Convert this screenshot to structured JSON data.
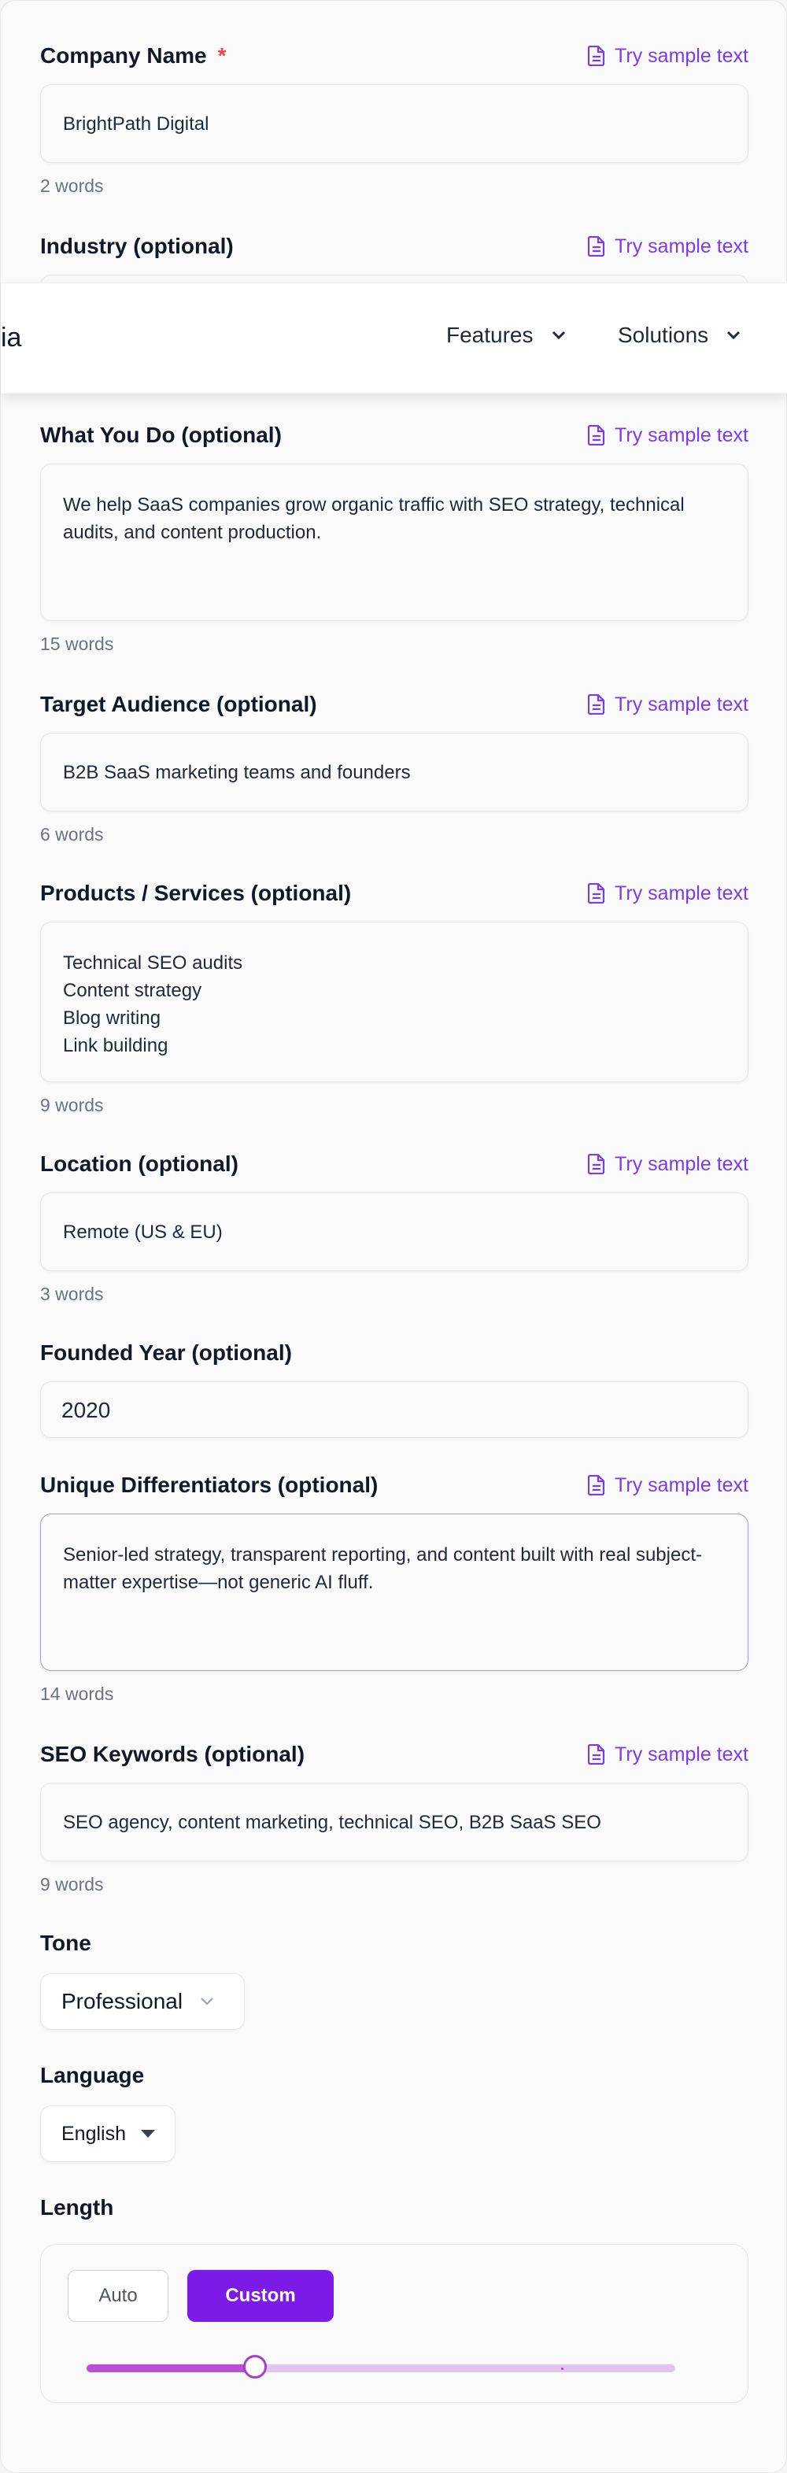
{
  "colors": {
    "accent": "#7c3aed",
    "required": "#ef4444",
    "custom_button": "#7c1ae8"
  },
  "try_sample_label": "Try sample text",
  "nav": {
    "logo_partial": "ia",
    "features_label": "Features",
    "solutions_label": "Solutions"
  },
  "company_name": {
    "label": "Company Name",
    "required_mark": "*",
    "value": "BrightPath Digital",
    "word_count": "2 words"
  },
  "industry": {
    "label": "Industry (optional)"
  },
  "what_you_do": {
    "label": "What You Do (optional)",
    "value": "We help SaaS companies grow organic traffic with SEO strategy, technical audits, and content production.",
    "word_count": "15 words"
  },
  "target_audience": {
    "label": "Target Audience (optional)",
    "value": "B2B SaaS marketing teams and founders",
    "word_count": "6 words"
  },
  "products_services": {
    "label": "Products / Services (optional)",
    "value": "Technical SEO audits\nContent strategy\nBlog writing\nLink building",
    "word_count": "9 words"
  },
  "location": {
    "label": "Location (optional)",
    "value": "Remote (US & EU)",
    "word_count": "3 words"
  },
  "founded_year": {
    "label": "Founded Year (optional)",
    "value": "2020"
  },
  "differentiators": {
    "label": "Unique Differentiators (optional)",
    "value": "Senior-led strategy, transparent reporting, and content built with real subject-matter expertise—not generic AI fluff.",
    "word_count": "14 words"
  },
  "seo_keywords": {
    "label": "SEO Keywords (optional)",
    "value": "SEO agency, content marketing, technical SEO, B2B SaaS SEO",
    "word_count": "9 words"
  },
  "tone": {
    "label": "Tone",
    "selected": "Professional"
  },
  "language": {
    "label": "Language",
    "selected": "English"
  },
  "length": {
    "label": "Length",
    "auto_label": "Auto",
    "custom_label": "Custom",
    "slider_fraction": 0.286
  }
}
